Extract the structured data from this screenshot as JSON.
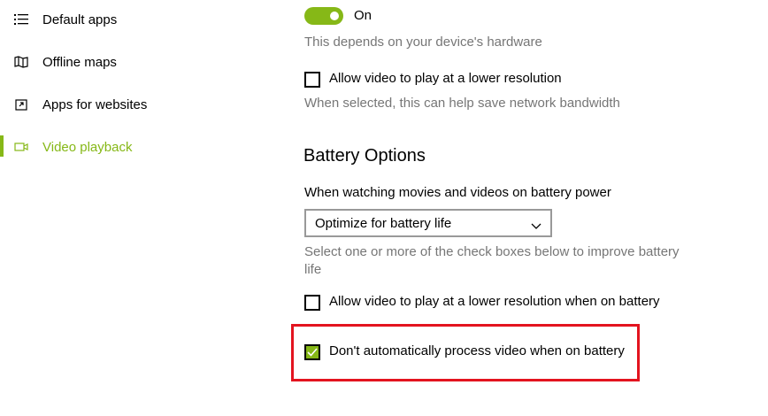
{
  "nav": {
    "items": [
      {
        "label": "Default apps",
        "icon": "list-icon"
      },
      {
        "label": "Offline maps",
        "icon": "map-icon"
      },
      {
        "label": "Apps for websites",
        "icon": "link-window-icon"
      },
      {
        "label": "Video playback",
        "icon": "video-icon",
        "active": true
      }
    ]
  },
  "hdr": {
    "toggle_state": "On",
    "hardware_note": "This depends on your device's hardware",
    "lower_res_label": "Allow video to play at a lower resolution",
    "lower_res_checked": false,
    "lower_res_note": "When selected, this can help save network bandwidth"
  },
  "battery": {
    "title": "Battery Options",
    "dropdown_label": "When watching movies and videos on battery power",
    "dropdown_value": "Optimize for battery life",
    "help_line1": "Select one or more of the check boxes below to improve battery",
    "help_line2": "life",
    "lower_res_battery_label": "Allow video to play at a lower resolution when on battery",
    "lower_res_battery_checked": false,
    "no_process_label": "Don't automatically process video when on battery",
    "no_process_checked": true
  },
  "colors": {
    "accent": "#86b817",
    "highlight_border": "#e3141f",
    "hint_text": "#767676"
  }
}
